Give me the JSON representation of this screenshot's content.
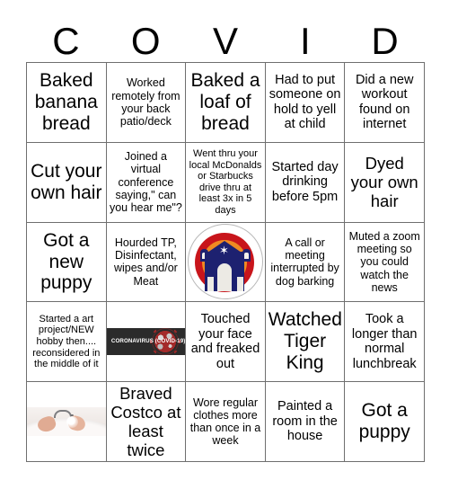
{
  "header": {
    "letters": [
      "C",
      "O",
      "V",
      "I",
      "D"
    ]
  },
  "grid": {
    "rows": [
      [
        {
          "kind": "text",
          "text": "Baked banana bread",
          "size": "xl"
        },
        {
          "kind": "text",
          "text": "Worked remotely from your back patio/deck",
          "size": "sm"
        },
        {
          "kind": "text",
          "text": "Baked a loaf of bread",
          "size": "xl"
        },
        {
          "kind": "text",
          "text": "Had to put someone on hold to yell at child",
          "size": "md"
        },
        {
          "kind": "text",
          "text": "Did a new workout found on internet",
          "size": "md"
        }
      ],
      [
        {
          "kind": "text",
          "text": "Cut your own hair",
          "size": "xl"
        },
        {
          "kind": "text",
          "text": "Joined a virtual conference saying,\" can you hear me\"?",
          "size": "sm"
        },
        {
          "kind": "text",
          "text": "Went thru your local McDonalds or Starbucks drive thru at least 3x in 5 days",
          "size": "xs"
        },
        {
          "kind": "text",
          "text": "Started day drinking before 5pm",
          "size": "md"
        },
        {
          "kind": "text",
          "text": "Dyed your own hair",
          "size": "lg"
        }
      ],
      [
        {
          "kind": "text",
          "text": "Got a new puppy",
          "size": "xl"
        },
        {
          "kind": "text",
          "text": "Hourded TP, Disinfectant, wipes and/or Meat",
          "size": "sm"
        },
        {
          "kind": "image",
          "image": "rainbow-synagogue-badge",
          "alt": "Circular badge with rainbow arc behind a navy building with a star and arched door"
        },
        {
          "kind": "text",
          "text": "A call or meeting interrupted by dog barking",
          "size": "sm"
        },
        {
          "kind": "text",
          "text": "Muted a zoom meeting so you could watch the news",
          "size": "sm"
        }
      ],
      [
        {
          "kind": "text",
          "text": "Started a art project/NEW hobby then.... reconsidered in the middle of it",
          "size": "xs"
        },
        {
          "kind": "image",
          "image": "coronavirus-banner",
          "alt": "Dark banner reading CORONAVIRUS (COVID-19) with a red virus particle",
          "caption": "CORONAVIRUS (COVID-19)"
        },
        {
          "kind": "text",
          "text": "Touched your face and freaked out",
          "size": "md"
        },
        {
          "kind": "text",
          "text": "Watched Tiger King",
          "size": "xl"
        },
        {
          "kind": "text",
          "text": "Took a longer than normal lunchbreak",
          "size": "md"
        }
      ],
      [
        {
          "kind": "image",
          "image": "handwashing-photo",
          "alt": "Hands being washed under a faucet in a white sink"
        },
        {
          "kind": "text",
          "text": "Braved Costco at least twice",
          "size": "lg"
        },
        {
          "kind": "text",
          "text": "Wore regular clothes more than once in a week",
          "size": "sm"
        },
        {
          "kind": "text",
          "text": "Painted a room in the house",
          "size": "md"
        },
        {
          "kind": "text",
          "text": "Got a puppy",
          "size": "xl"
        }
      ]
    ]
  },
  "colors": {
    "grid_line": "#6f6f6f",
    "text": "#000000",
    "background": "#ffffff",
    "badge_red": "#c8151b",
    "badge_orange": "#ef8a22",
    "badge_yellow": "#f6c95c",
    "badge_navy": "#1d2170",
    "banner_background": "#2b2b2b",
    "virus_red": "#a32a2a"
  }
}
